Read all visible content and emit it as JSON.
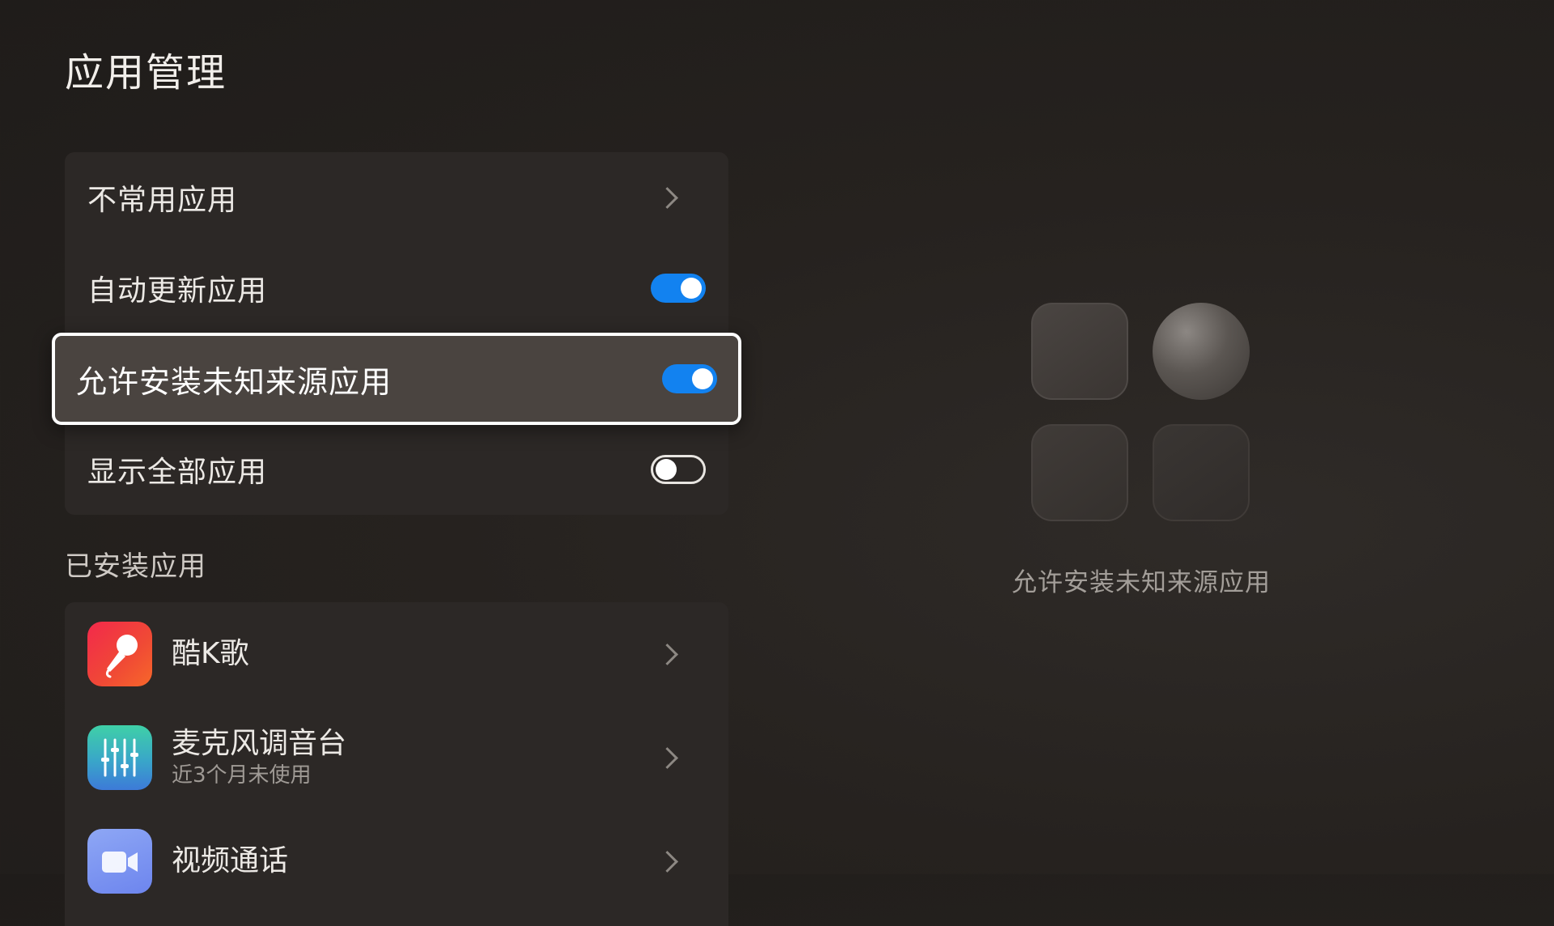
{
  "page": {
    "title": "应用管理"
  },
  "settings": {
    "rows": [
      {
        "label": "不常用应用",
        "control": "chevron"
      },
      {
        "label": "自动更新应用",
        "control": "toggle",
        "checked": true
      },
      {
        "label": "允许安装未知来源应用",
        "control": "toggle",
        "checked": true,
        "focused": true
      },
      {
        "label": "显示全部应用",
        "control": "toggle",
        "checked": false
      }
    ]
  },
  "installed": {
    "section_title": "已安装应用",
    "apps": [
      {
        "name": "酷K歌",
        "subtitle": "",
        "icon": "karaoke-microphone-icon"
      },
      {
        "name": "麦克风调音台",
        "subtitle": "近3个月未使用",
        "icon": "mixer-sliders-icon"
      },
      {
        "name": "视频通话",
        "subtitle": "",
        "icon": "video-call-icon"
      }
    ]
  },
  "preview": {
    "caption": "允许安装未知来源应用",
    "icon": "app-grid-illustration"
  },
  "colors": {
    "accent": "#1282f0",
    "background": "#221f1d",
    "card": "#2c2826",
    "focus_border": "#ffffff"
  }
}
